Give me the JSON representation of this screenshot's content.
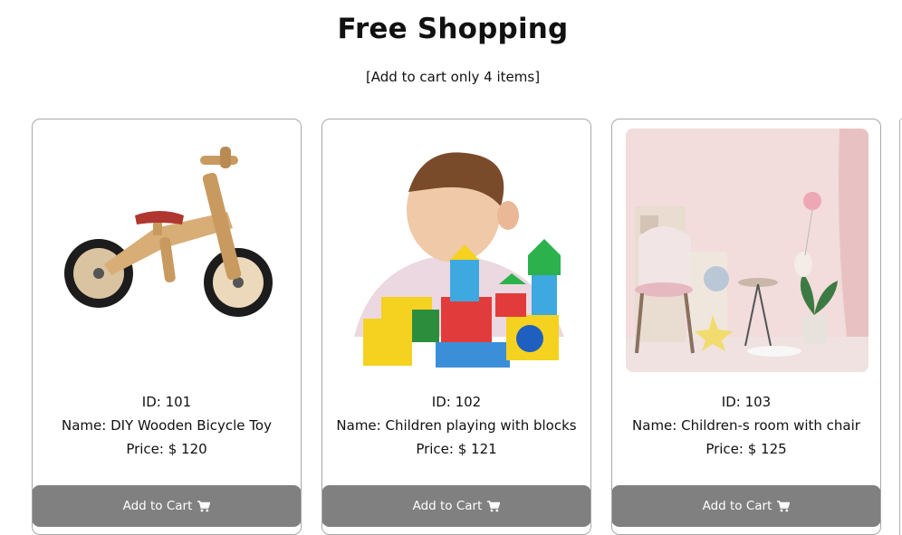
{
  "page": {
    "title": "Free Shopping",
    "subtitle": "[Add to cart only 4 items]"
  },
  "products": [
    {
      "id": "ID: 101",
      "name": "Name: DIY Wooden Bicycle Toy",
      "price": "Price: $ 120",
      "image": "wooden-balance-bike-image",
      "button": "Add to Cart",
      "button_icon": "shopping-cart-icon"
    },
    {
      "id": "ID: 102",
      "name": "Name: Children playing with blocks",
      "price": "Price: $ 121",
      "image": "child-with-toy-blocks-image",
      "button": "Add to Cart",
      "button_icon": "shopping-cart-icon"
    },
    {
      "id": "ID: 103",
      "name": "Name: Children-s room with chair",
      "price": "Price: $ 125",
      "image": "childrens-room-with-chair-image",
      "button": "Add to Cart",
      "button_icon": "shopping-cart-icon"
    }
  ],
  "colors": {
    "button_bg": "#808080",
    "card_border": "#a8a8a8"
  }
}
